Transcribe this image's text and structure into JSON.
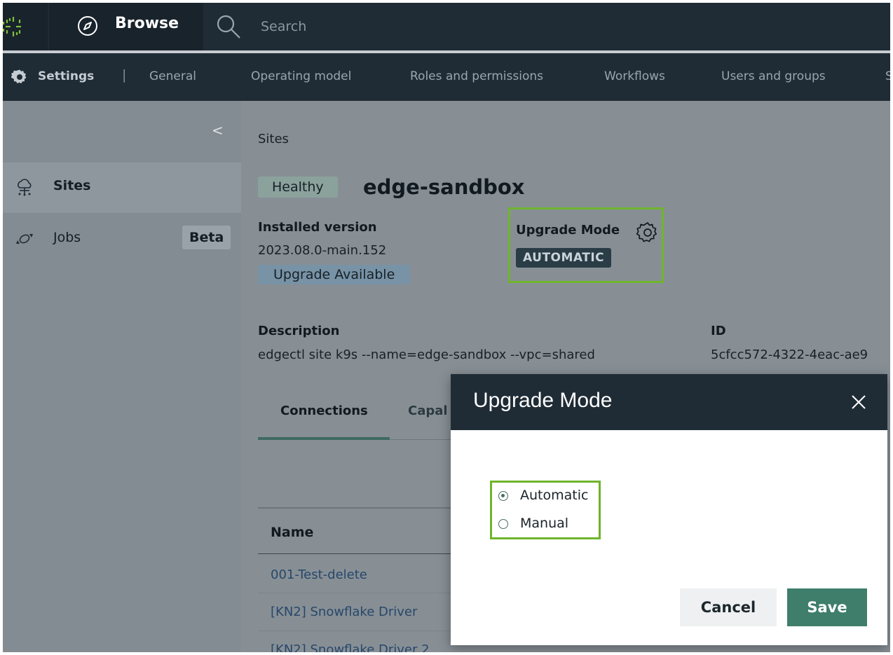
{
  "topbar": {
    "browse_label": "Browse",
    "search_placeholder": "Search"
  },
  "settings_nav": {
    "settings_label": "Settings",
    "separator": "|",
    "items": [
      "General",
      "Operating model",
      "Roles and permissions",
      "Workflows",
      "Users and groups",
      "S"
    ]
  },
  "sidebar": {
    "collapse_glyph": "<",
    "items": [
      {
        "label": "Sites",
        "icon": "cloud-network-icon",
        "active": true
      },
      {
        "label": "Jobs",
        "icon": "sync-arrows-icon",
        "badge": "Beta"
      }
    ]
  },
  "site": {
    "breadcrumb": "Sites",
    "health": "Healthy",
    "name": "edge-sandbox",
    "installed_version_label": "Installed version",
    "installed_version": "2023.08.0-main.152",
    "upgrade_available": "Upgrade Available",
    "upgrade_mode_label": "Upgrade Mode",
    "upgrade_mode_value": "AUTOMATIC",
    "description_label": "Description",
    "description": "edgectl site k9s --name=edge-sandbox --vpc=shared",
    "id_label": "ID",
    "id": "5cfcc572-4322-4eac-ae9"
  },
  "tabs": [
    "Connections",
    "Capal"
  ],
  "table": {
    "header": "Name",
    "rows": [
      "001-Test-delete",
      "[KN2] Snowflake Driver",
      "[KN2] Snowflake Driver 2"
    ]
  },
  "modal": {
    "title": "Upgrade Mode",
    "options": [
      {
        "label": "Automatic",
        "selected": true
      },
      {
        "label": "Manual",
        "selected": false
      }
    ],
    "cancel_label": "Cancel",
    "save_label": "Save"
  },
  "colors": {
    "topbar_bg": "#1f2c36",
    "highlight_border": "#6fb52c",
    "save_button": "#3e7e6a",
    "link": "#27476a"
  }
}
